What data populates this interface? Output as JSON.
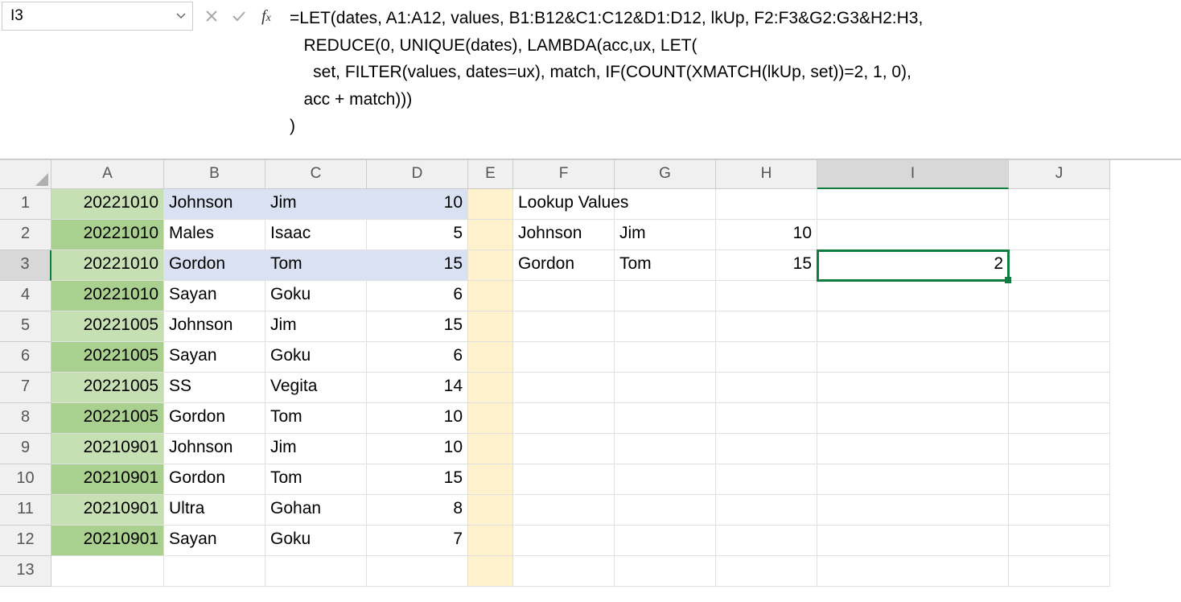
{
  "name_box": "I3",
  "formula": "=LET(dates, A1:A12, values, B1:B12&C1:C12&D1:D12, lkUp, F2:F3&G2:G3&H2:H3,\n   REDUCE(0, UNIQUE(dates), LAMBDA(acc,ux, LET(\n     set, FILTER(values, dates=ux), match, IF(COUNT(XMATCH(lkUp, set))=2, 1, 0),\n   acc + match)))\n)",
  "columns": [
    "A",
    "B",
    "C",
    "D",
    "E",
    "F",
    "G",
    "H",
    "I",
    "J"
  ],
  "rows": [
    "1",
    "2",
    "3",
    "4",
    "5",
    "6",
    "7",
    "8",
    "9",
    "10",
    "11",
    "12",
    "13"
  ],
  "active_cell": "I3",
  "data": {
    "A1": "20221010",
    "B1": "Johnson",
    "C1": "Jim",
    "D1": "10",
    "A2": "20221010",
    "B2": "Males",
    "C2": "Isaac",
    "D2": "5",
    "A3": "20221010",
    "B3": "Gordon",
    "C3": "Tom",
    "D3": "15",
    "A4": "20221010",
    "B4": "Sayan",
    "C4": "Goku",
    "D4": "6",
    "A5": "20221005",
    "B5": "Johnson",
    "C5": "Jim",
    "D5": "15",
    "A6": "20221005",
    "B6": "Sayan",
    "C6": "Goku",
    "D6": "6",
    "A7": "20221005",
    "B7": "SS",
    "C7": "Vegita",
    "D7": "14",
    "A8": "20221005",
    "B8": "Gordon",
    "C8": "Tom",
    "D8": "10",
    "A9": "20210901",
    "B9": "Johnson",
    "C9": "Jim",
    "D9": "10",
    "A10": "20210901",
    "B10": "Gordon",
    "C10": "Tom",
    "D10": "15",
    "A11": "20210901",
    "B11": "Ultra",
    "C11": "Gohan",
    "D11": "8",
    "A12": "20210901",
    "B12": "Sayan",
    "C12": "Goku",
    "D12": "7",
    "F1": "Lookup Values",
    "F2": "Johnson",
    "G2": "Jim",
    "H2": "10",
    "F3": "Gordon",
    "G3": "Tom",
    "H3": "15",
    "I3": "2"
  },
  "greenA_rows": [
    "1",
    "3",
    "5",
    "7",
    "9",
    "11"
  ],
  "greenB_rows": [
    "2",
    "4",
    "6",
    "8",
    "10",
    "12"
  ],
  "blue_rows": [
    "1",
    "3"
  ],
  "tan_rows_all": true
}
